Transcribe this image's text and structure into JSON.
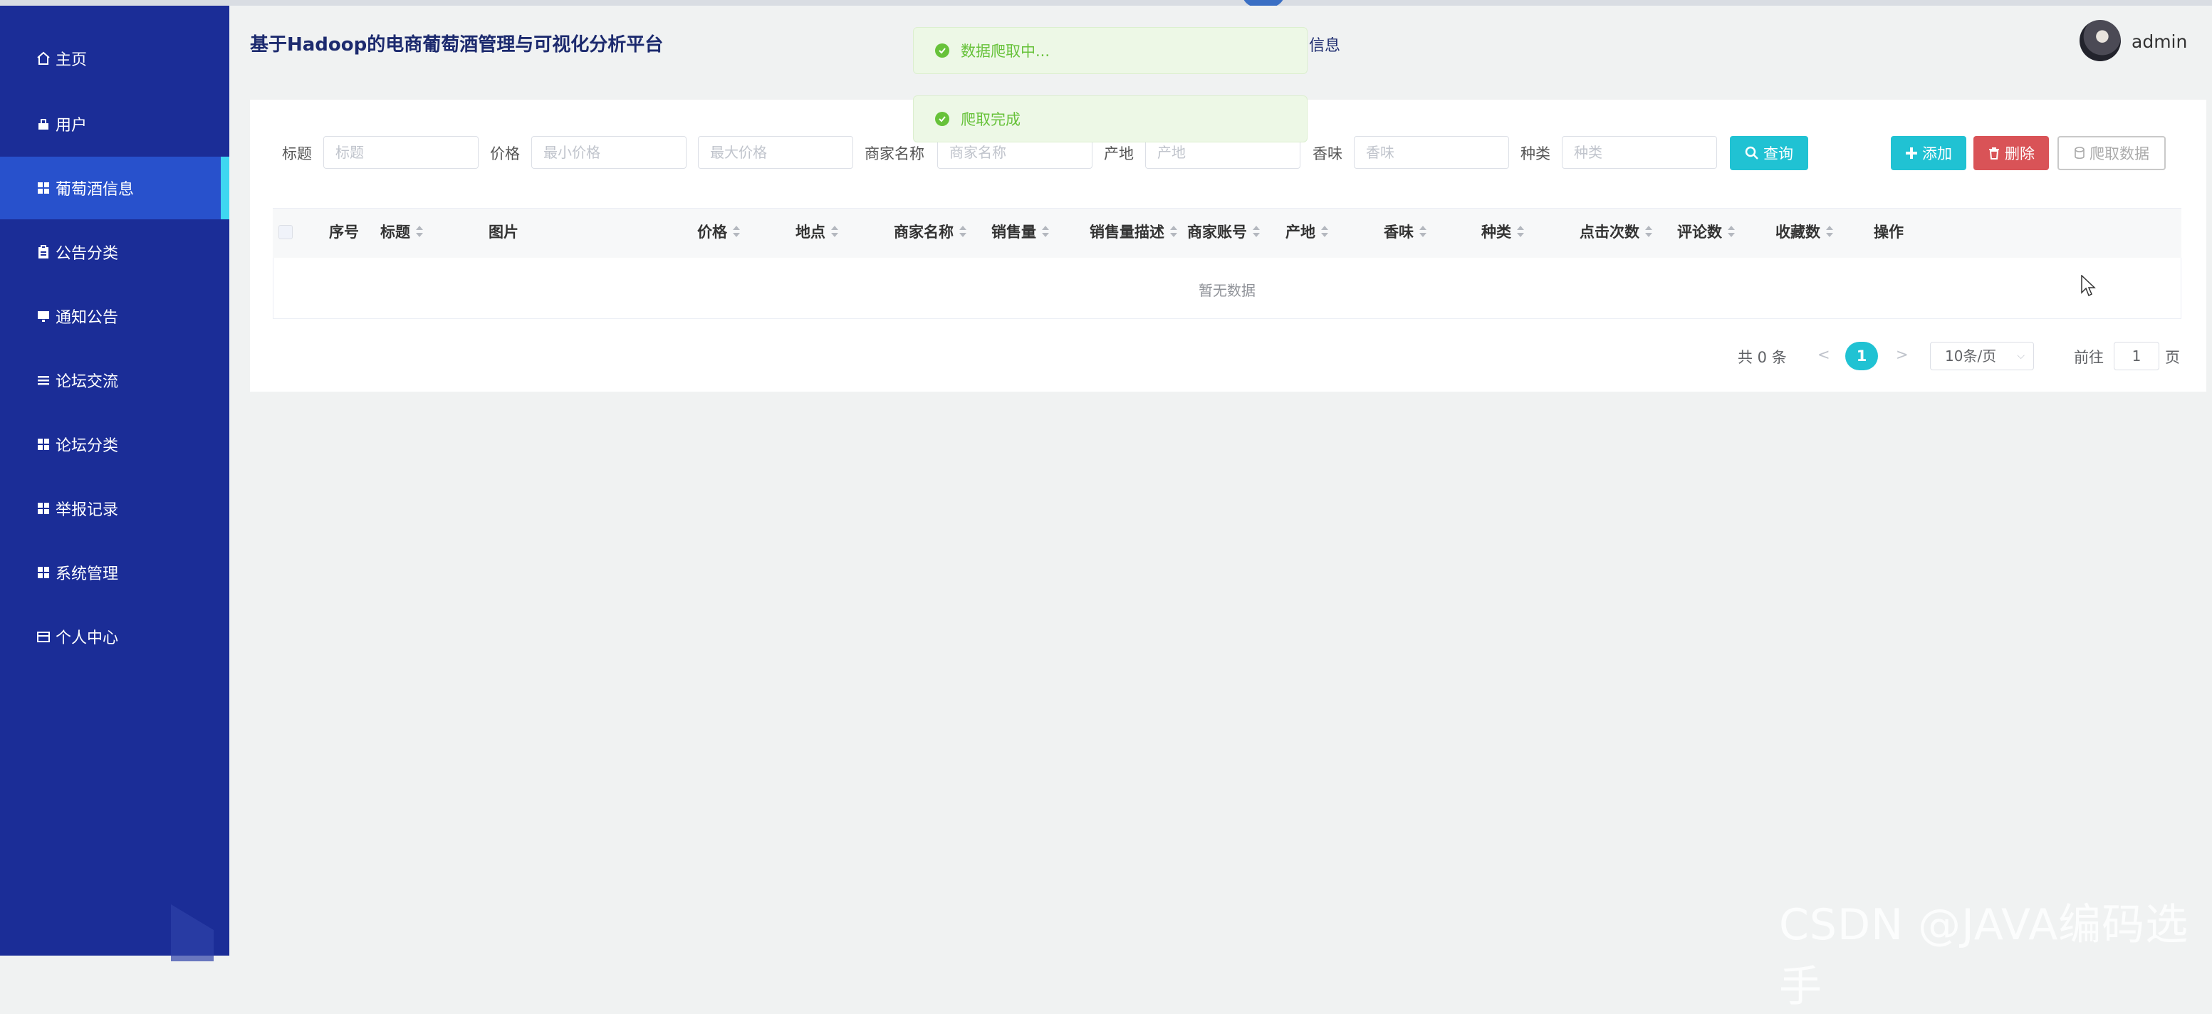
{
  "app": {
    "title": "基于Hadoop的电商葡萄酒管理与可视化分析平台",
    "nav_fragment": "信息",
    "user": "admin"
  },
  "sidebar": {
    "items": [
      {
        "label": "主页",
        "icon": "home-icon"
      },
      {
        "label": "用户",
        "icon": "user-icon"
      },
      {
        "label": "葡萄酒信息",
        "icon": "grid-icon",
        "active": true
      },
      {
        "label": "公告分类",
        "icon": "clipboard-icon"
      },
      {
        "label": "通知公告",
        "icon": "monitor-icon"
      },
      {
        "label": "论坛交流",
        "icon": "list-icon"
      },
      {
        "label": "论坛分类",
        "icon": "grid-icon"
      },
      {
        "label": "举报记录",
        "icon": "grid-icon"
      },
      {
        "label": "系统管理",
        "icon": "grid-icon"
      },
      {
        "label": "个人中心",
        "icon": "card-icon"
      }
    ]
  },
  "filters": {
    "title_label": "标题",
    "title_placeholder": "标题",
    "price_label": "价格",
    "min_price_placeholder": "最小价格",
    "max_price_placeholder": "最大价格",
    "merchant_label": "商家名称",
    "merchant_placeholder": "商家名称",
    "origin_label": "产地",
    "origin_placeholder": "产地",
    "aroma_label": "香味",
    "aroma_placeholder": "香味",
    "type_label": "种类",
    "type_placeholder": "种类"
  },
  "buttons": {
    "search": "查询",
    "add": "添加",
    "delete": "删除",
    "crawl": "爬取数据"
  },
  "table": {
    "columns": [
      "序号",
      "标题",
      "图片",
      "价格",
      "地点",
      "商家名称",
      "销售量",
      "销售量描述",
      "商家账号",
      "产地",
      "香味",
      "种类",
      "点击次数",
      "评论数",
      "收藏数",
      "操作"
    ],
    "empty_text": "暂无数据"
  },
  "pagination": {
    "total": "共 0 条",
    "prev": "<",
    "current": "1",
    "next": ">",
    "page_size": "10条/页",
    "goto_label": "前往",
    "goto_value": "1",
    "page_suffix": "页"
  },
  "toasts": [
    "数据爬取中...",
    "爬取完成"
  ],
  "watermark": "CSDN @JAVA编码选手",
  "colors": {
    "sidebar": "#1b2d97",
    "sidebar_active": "#2851cc",
    "accent": "#20c2d3",
    "danger": "#d95357",
    "success": "#67c23a"
  }
}
